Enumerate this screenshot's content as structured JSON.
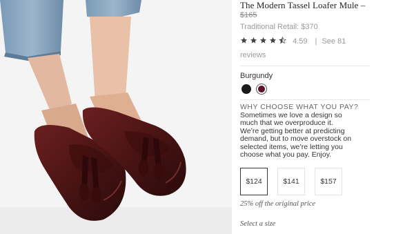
{
  "product": {
    "title": "The Modern Tassel Loafer Mule –",
    "price_old": "$165",
    "retail": "Traditional Retail: $370"
  },
  "rating": {
    "score": "4.59",
    "separator": "|",
    "see_link": "See 81",
    "reviews_word": "reviews",
    "stars_value": 4.5,
    "stars_max": 5
  },
  "color": {
    "selected_name": "Burgundy",
    "swatches": [
      {
        "name": "Black",
        "hex": "#1b1b1b"
      },
      {
        "name": "Burgundy",
        "hex": "#5a1428"
      }
    ]
  },
  "why": {
    "title": "WHY CHOOSE WHAT YOU PAY?",
    "body": "Sometimes we love a design so much that we overproduce it. We’re getting better at predicting demand, but to move overstock on selected items, we’re letting you choose what you pay. Enjoy."
  },
  "prices": [
    {
      "label": "$124",
      "selected": true
    },
    {
      "label": "$141",
      "selected": false
    },
    {
      "label": "$157",
      "selected": false
    }
  ],
  "discount_note": "25% off the original price",
  "size_prompt": "Select a size",
  "colors": {
    "star": "#444444",
    "muted_text": "#9a9a9a",
    "divider": "#e6e6e6",
    "shoe": "#4a1616"
  }
}
